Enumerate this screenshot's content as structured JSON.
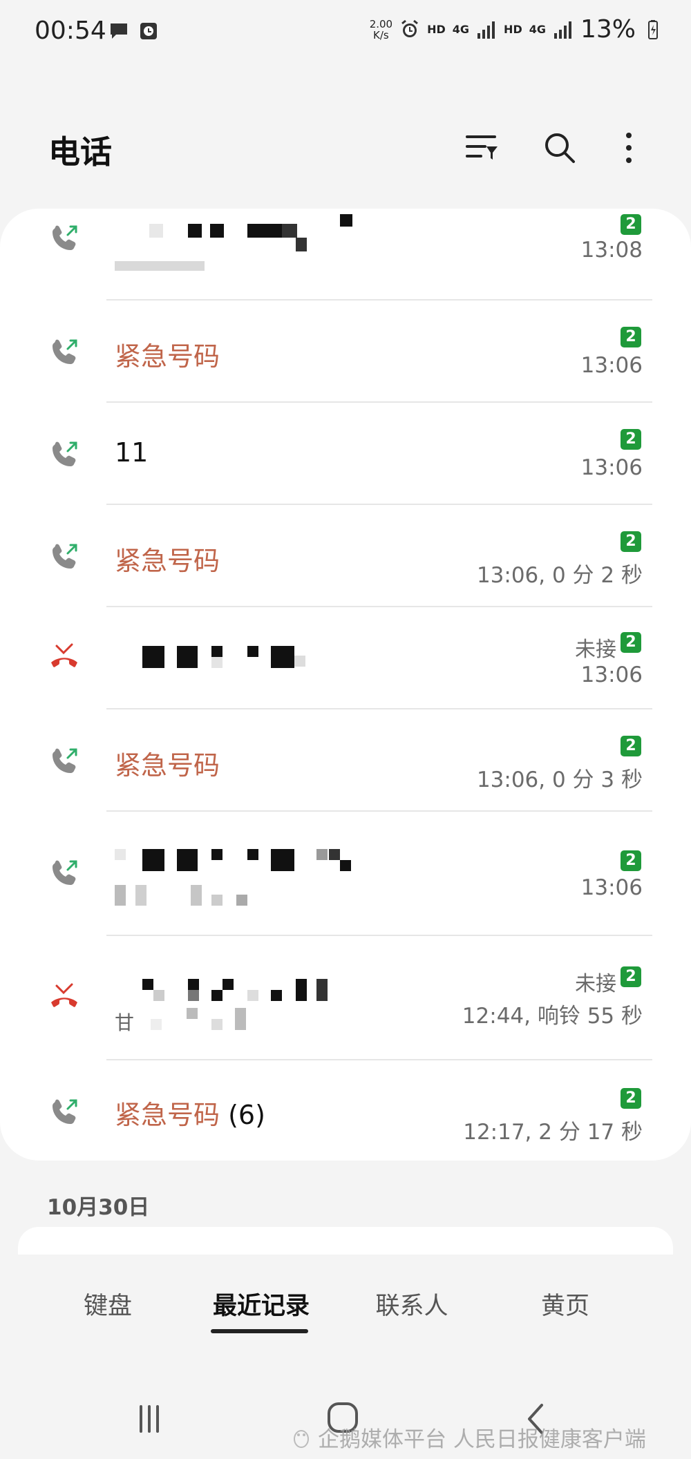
{
  "status_bar": {
    "time": "00:54",
    "net_speed_value": "2.00",
    "net_speed_unit": "K/s",
    "hd1": "HD",
    "net1": "4G",
    "hd2": "HD",
    "net2": "4G",
    "battery": "13%"
  },
  "header": {
    "title": "电话"
  },
  "calls": [
    {
      "name": "",
      "type": "outgoing",
      "badge": "2",
      "time": "13:08",
      "missed": ""
    },
    {
      "name": "紧急号码",
      "type": "outgoing",
      "badge": "2",
      "time": "13:06",
      "missed": ""
    },
    {
      "name": "11",
      "type": "outgoing",
      "badge": "2",
      "time": "13:06",
      "missed": ""
    },
    {
      "name": "紧急号码",
      "type": "outgoing",
      "badge": "2",
      "time": "13:06, 0 分 2 秒",
      "missed": ""
    },
    {
      "name": "",
      "type": "missed",
      "badge": "2",
      "time": "13:06",
      "missed": "未接"
    },
    {
      "name": "紧急号码",
      "type": "outgoing",
      "badge": "2",
      "time": "13:06, 0 分 3 秒",
      "missed": ""
    },
    {
      "name": "",
      "type": "outgoing",
      "badge": "2",
      "time": "13:06",
      "missed": ""
    },
    {
      "name": "",
      "sub": "甘",
      "type": "missed",
      "badge": "2",
      "time": "12:44, 响铃 55 秒",
      "missed": "未接"
    },
    {
      "name": "紧急号码",
      "count": "(6)",
      "type": "outgoing",
      "badge": "2",
      "time": "12:17, 2 分 17 秒",
      "missed": ""
    }
  ],
  "date_section": "10月30日",
  "tabs": [
    {
      "label": "键盘"
    },
    {
      "label": "最近记录"
    },
    {
      "label": "联系人"
    },
    {
      "label": "黄页"
    }
  ],
  "active_tab": "最近记录",
  "watermark": "企鹅媒体平台 人民日报健康客户端",
  "colors": {
    "emergency_name": "#c0654a",
    "outgoing_arrow": "#2fae6a",
    "missed_red": "#d83a2e",
    "sim_badge": "#1f9a3a"
  }
}
